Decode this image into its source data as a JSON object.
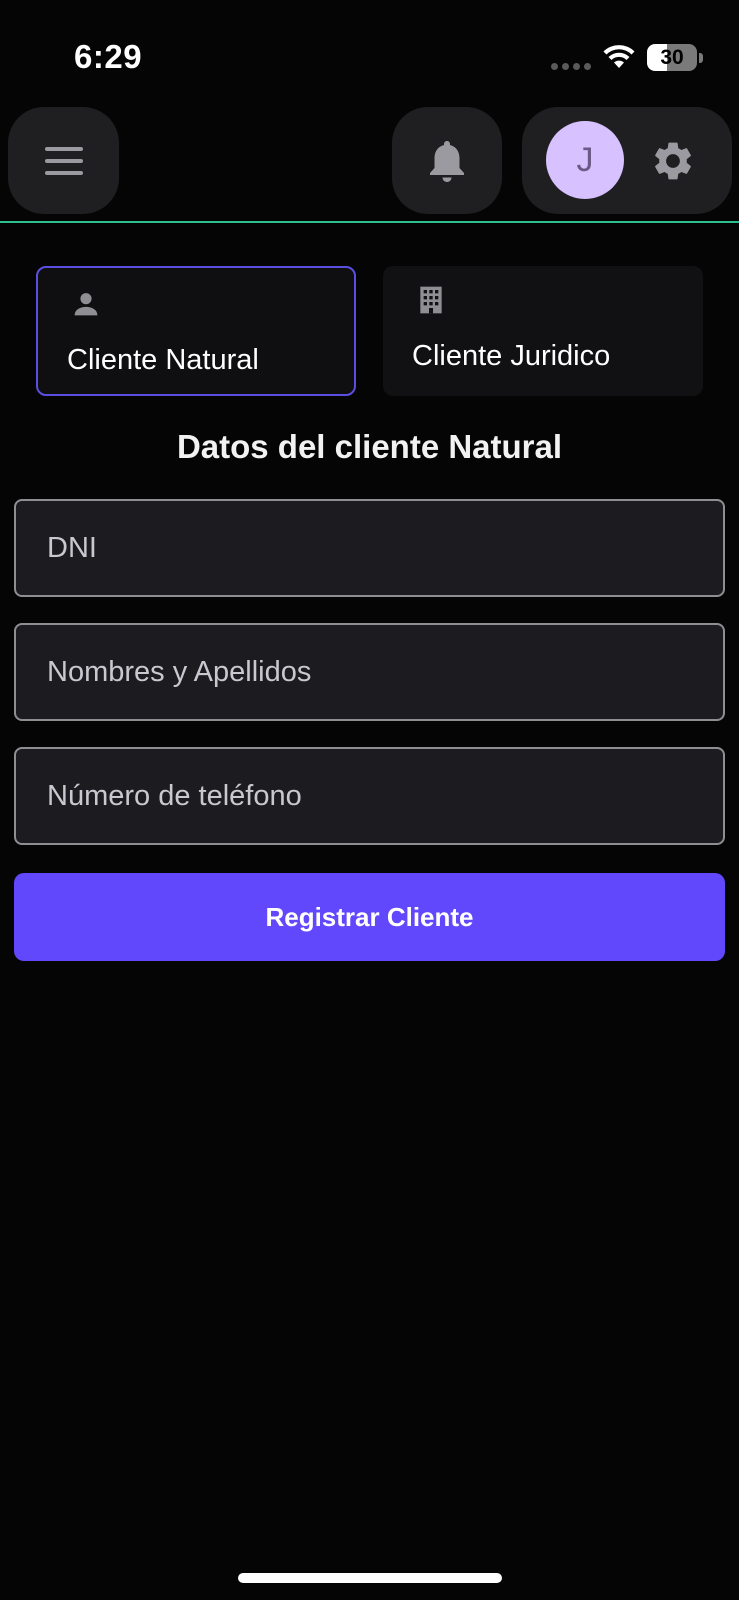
{
  "status_bar": {
    "time": "6:29",
    "battery_level": "30",
    "battery_fraction": 0.3
  },
  "header": {
    "menu_icon": "hamburger-menu-icon",
    "notification_icon": "bell-icon",
    "avatar_initial": "J",
    "settings_icon": "gear-icon"
  },
  "client_types": {
    "natural": {
      "label": "Cliente Natural",
      "icon": "person-icon",
      "selected": true
    },
    "juridico": {
      "label": "Cliente Juridico",
      "icon": "building-icon",
      "selected": false
    }
  },
  "form": {
    "title": "Datos del cliente Natural",
    "dni_placeholder": "DNI",
    "name_placeholder": "Nombres y Apellidos",
    "phone_placeholder": "Número de teléfono",
    "submit_label": "Registrar Cliente"
  },
  "colors": {
    "background": "#050505",
    "accent": "#6248fd",
    "selected_border": "#5a4fe0",
    "header_divider": "#2dbf8f",
    "avatar_bg": "#d7c2ff"
  }
}
